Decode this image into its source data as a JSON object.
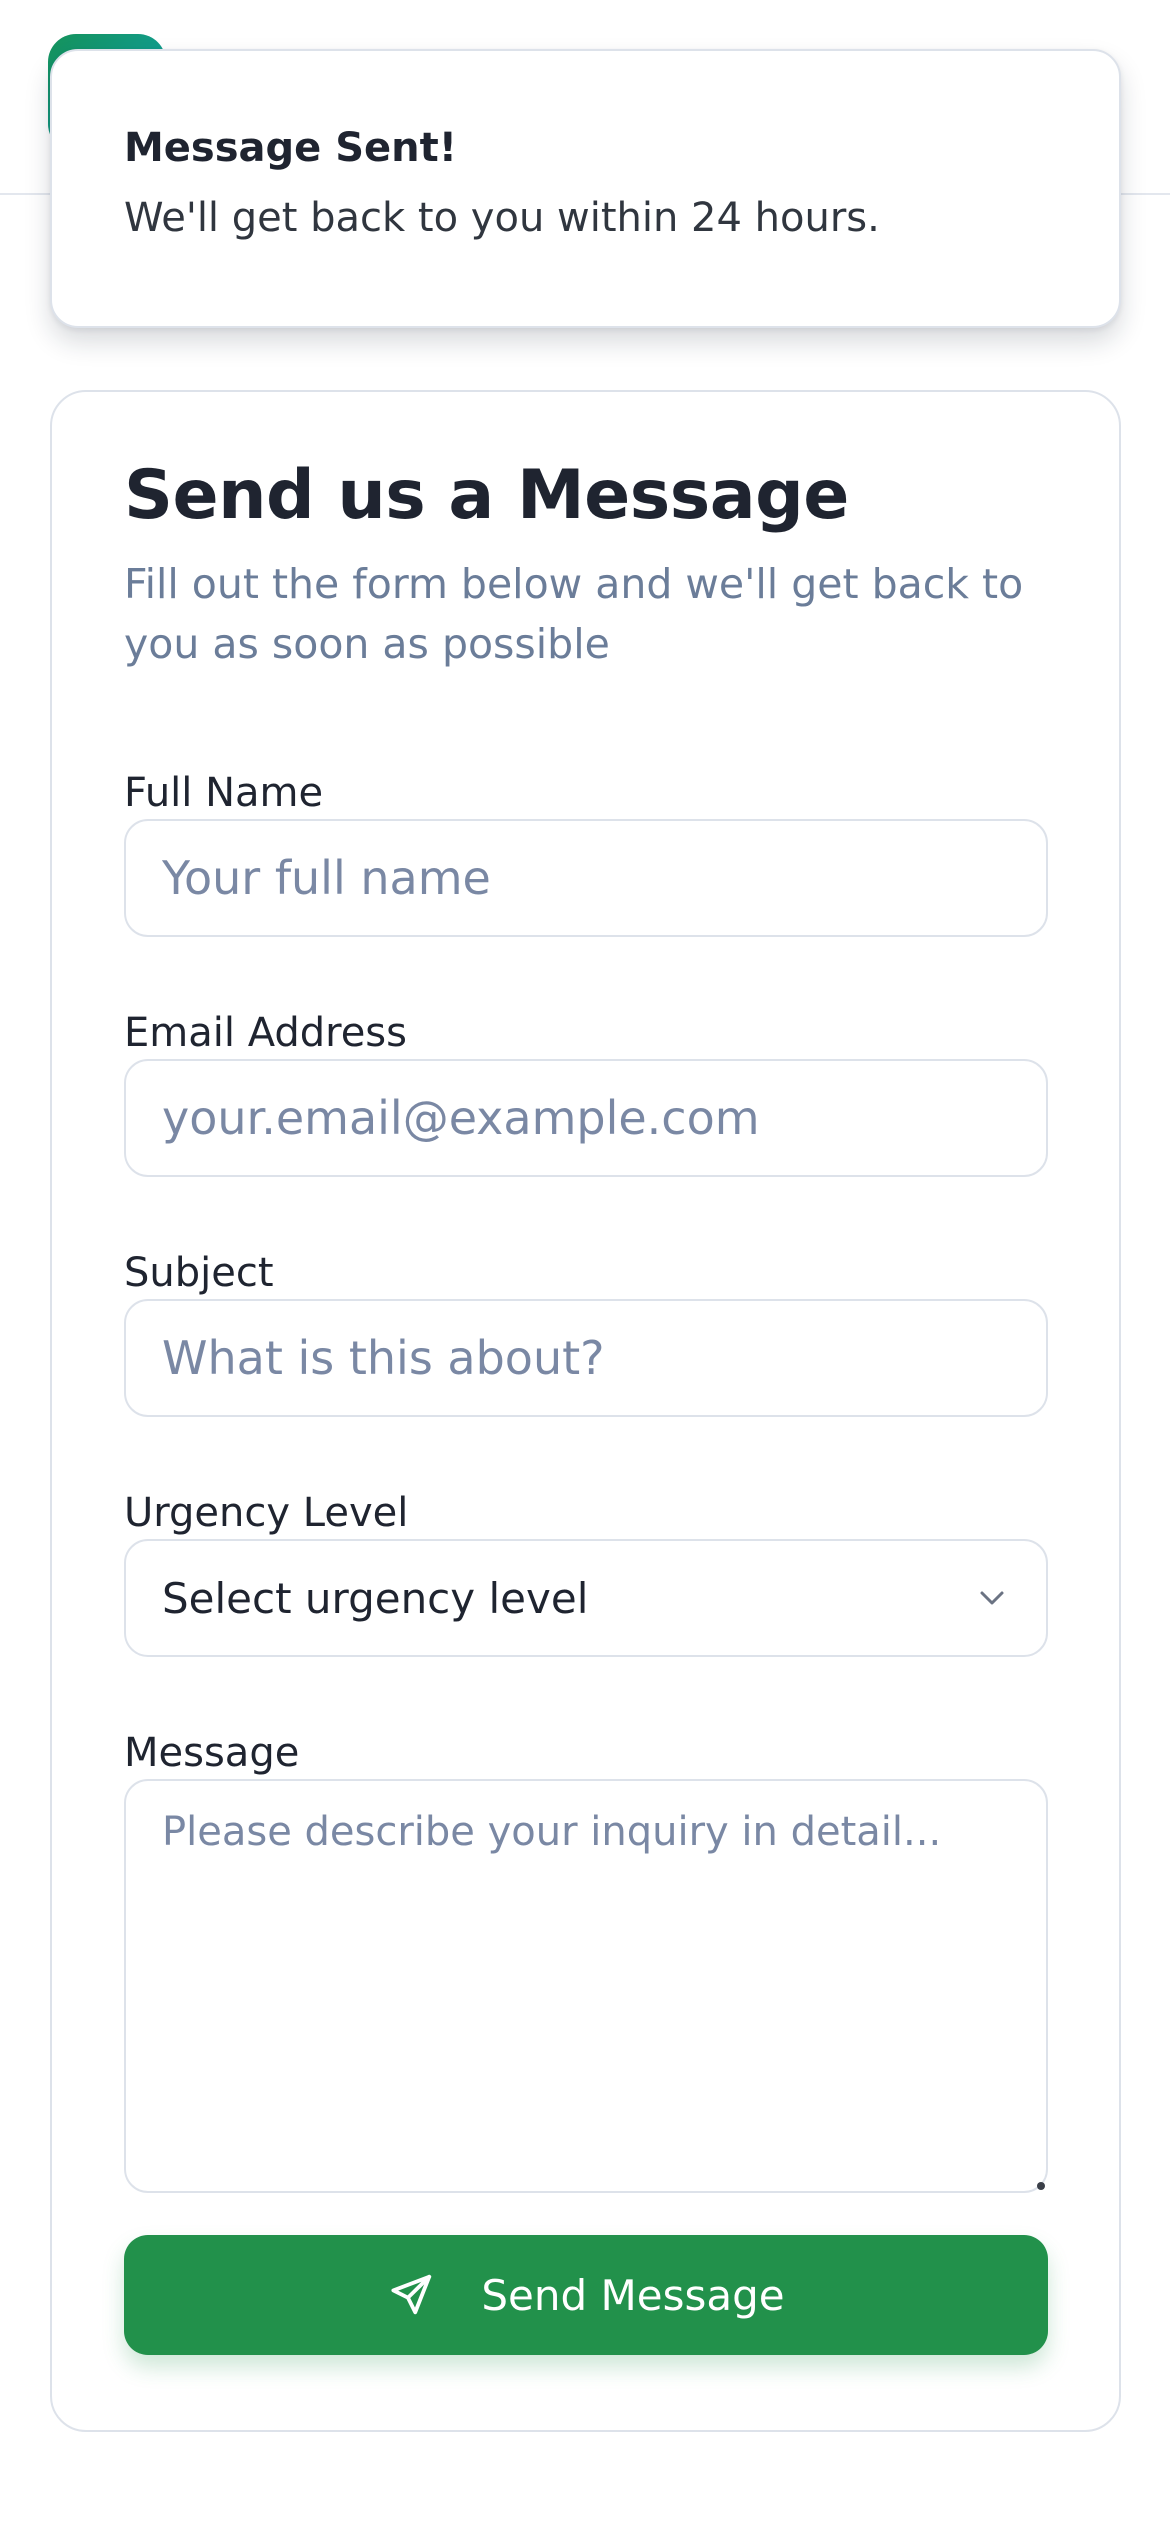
{
  "toast": {
    "title": "Message Sent!",
    "body": "We'll get back to you within 24 hours."
  },
  "form": {
    "title": "Send us a Message",
    "subtitle": "Fill out the form below and we'll get back to you as soon as possible",
    "full_name": {
      "label": "Full Name",
      "placeholder": "Your full name",
      "value": ""
    },
    "email": {
      "label": "Email Address",
      "placeholder": "your.email@example.com",
      "value": ""
    },
    "subject": {
      "label": "Subject",
      "placeholder": "What is this about?",
      "value": ""
    },
    "urgency": {
      "label": "Urgency Level",
      "selected": "Select urgency level",
      "icon": "chevron-down-icon"
    },
    "message": {
      "label": "Message",
      "placeholder": "Please describe your inquiry in detail...",
      "value": ""
    },
    "submit": {
      "label": "Send Message",
      "icon": "send-icon"
    }
  },
  "colors": {
    "primary_button": "#22914b",
    "brand_gradient_start": "#15925a",
    "brand_gradient_end": "#0fa4b5",
    "muted_text": "#6b7d99",
    "border": "#dde2ea"
  }
}
